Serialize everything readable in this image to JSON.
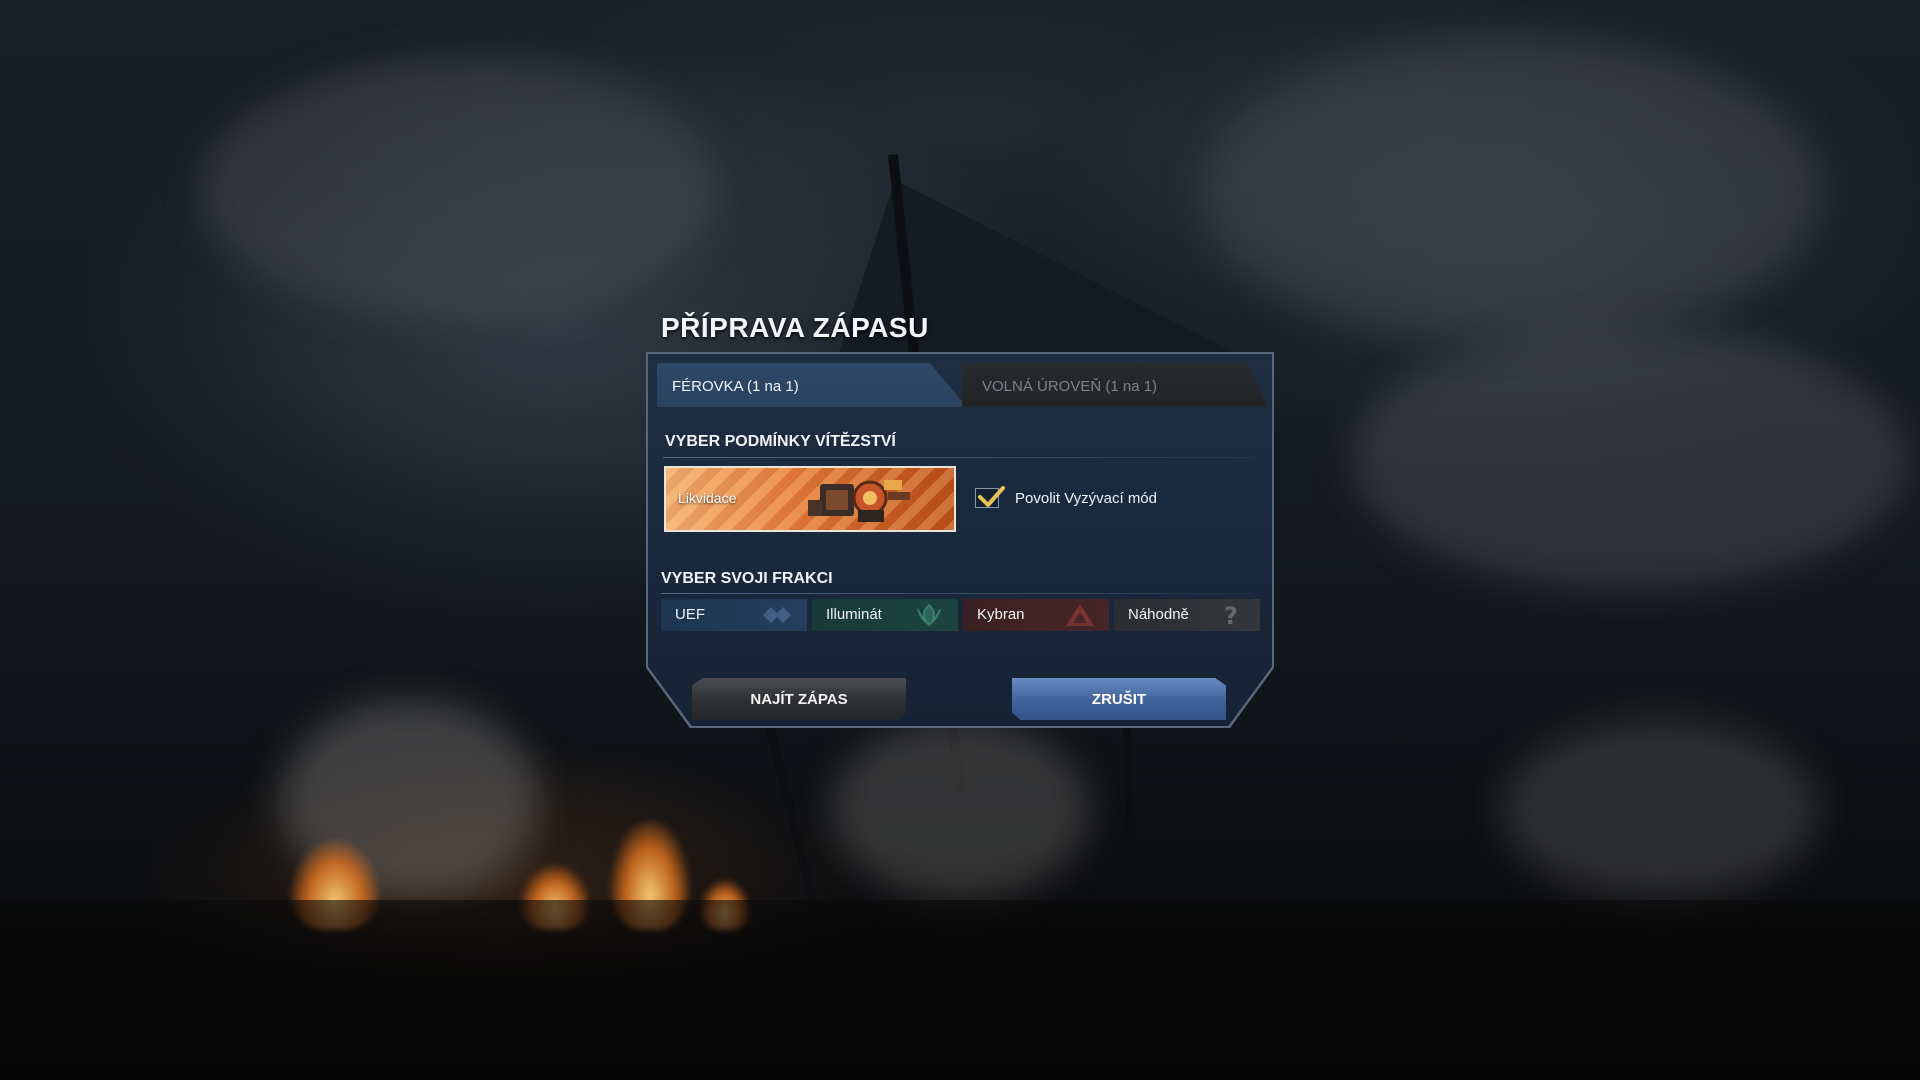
{
  "dialog": {
    "title": "PŘÍPRAVA ZÁPASU",
    "tabs": [
      {
        "label": "FÉROVKA (1 na 1)",
        "active": true
      },
      {
        "label": "VOLNÁ ÚROVEŇ (1 na 1)",
        "active": false
      }
    ],
    "victory": {
      "heading": "VYBER PODMÍNKY VÍTĚZSTVÍ",
      "selected_label": "Likvidace",
      "challenge_mode": {
        "label": "Povolit Vyzývací mód",
        "checked": true
      }
    },
    "faction": {
      "heading": "VYBER SVOJI FRAKCI",
      "options": [
        {
          "label": "UEF",
          "icon": "uef-emblem-icon",
          "color": "#24405e"
        },
        {
          "label": "Illuminát",
          "icon": "illuminate-emblem-icon",
          "color": "#1c4440"
        },
        {
          "label": "Kybran",
          "icon": "cybran-emblem-icon",
          "color": "#452628"
        },
        {
          "label": "Náhodně",
          "icon": "question-mark-icon",
          "color": "#33363a"
        }
      ]
    },
    "buttons": {
      "find": "NAJÍT ZÁPAS",
      "cancel": "ZRUŠIT"
    }
  },
  "colors": {
    "accent_blue": "#3f6298",
    "panel": "#1e2d40",
    "frame": "#56687d"
  }
}
